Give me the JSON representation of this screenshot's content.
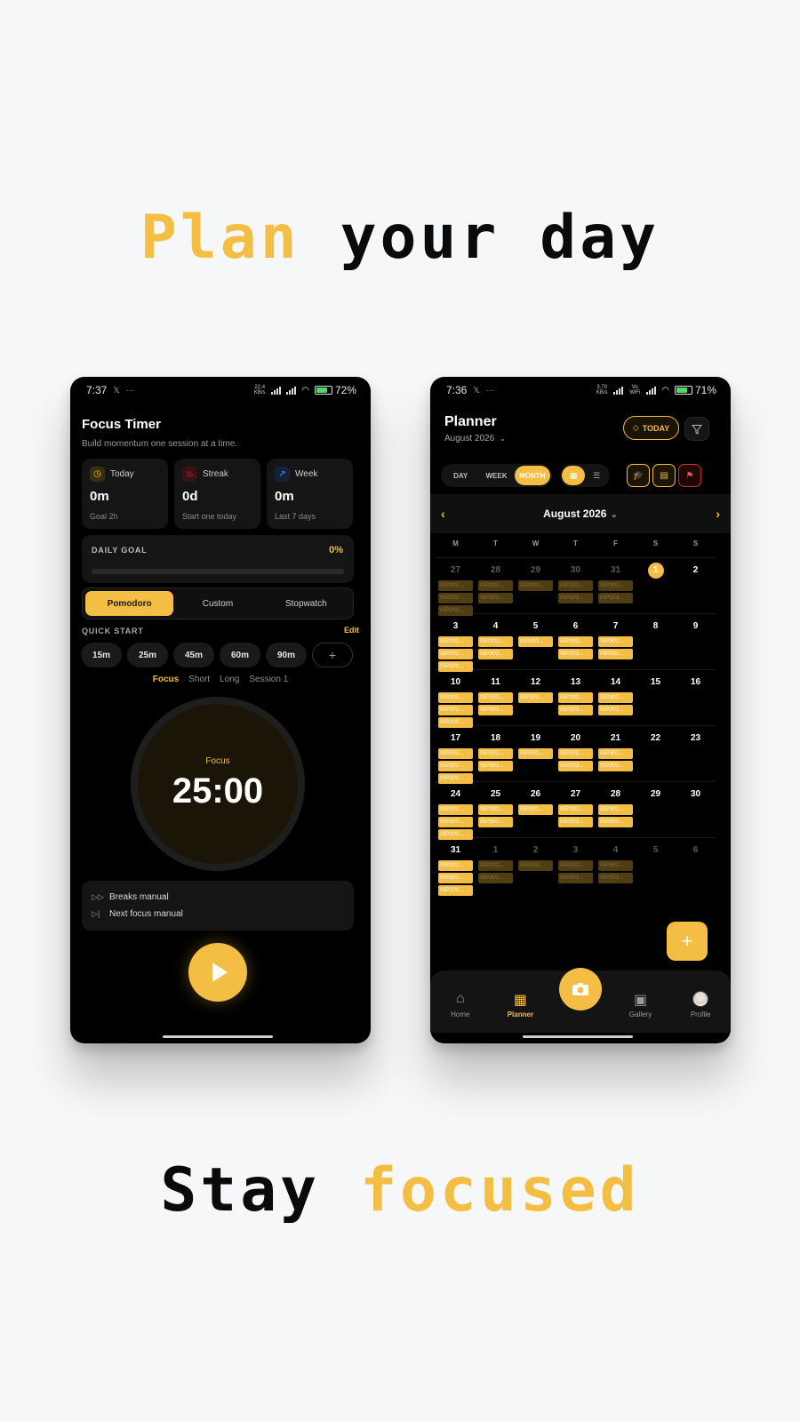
{
  "headline_top": {
    "word1": "Plan",
    "word2": "your day"
  },
  "headline_bottom": {
    "word1": "Stay",
    "word2": "focused"
  },
  "colors": {
    "accent": "#f4bd44",
    "background": "#f6f7f9",
    "phone_bg": "#000000"
  },
  "focus_phone": {
    "status": {
      "time": "7:37",
      "icon": "x-icon",
      "dots": "···",
      "net_speed": "22.4 KB/s",
      "battery": "72%"
    },
    "title": "Focus Timer",
    "subtitle": "Build momentum one session at a time.",
    "stats": [
      {
        "label": "Today",
        "value": "0m",
        "note": "Goal 2h",
        "icon": "clock-icon"
      },
      {
        "label": "Streak",
        "value": "0d",
        "note": "Start one today",
        "icon": "flame-icon"
      },
      {
        "label": "Week",
        "value": "0m",
        "note": "Last 7 days",
        "icon": "trend-icon"
      }
    ],
    "daily_goal": {
      "label": "DAILY GOAL",
      "percent": "0%",
      "progress": 0
    },
    "modes": [
      "Pomodoro",
      "Custom",
      "Stopwatch"
    ],
    "active_mode": "Pomodoro",
    "quick_start": {
      "label": "QUICK START",
      "edit": "Edit",
      "presets": [
        "15m",
        "25m",
        "45m",
        "60m",
        "90m"
      ],
      "add": "+"
    },
    "phases": [
      "Focus",
      "Short",
      "Long",
      "Session 1"
    ],
    "timer": {
      "label": "Focus",
      "time": "25:00"
    },
    "auto": [
      {
        "icon": "fast-forward-icon",
        "glyph": "▷▷",
        "text": "Breaks manual"
      },
      {
        "icon": "skip-icon",
        "glyph": "▷|",
        "text": "Next focus manual"
      }
    ]
  },
  "planner_phone": {
    "status": {
      "time": "7:36",
      "icon": "x-icon",
      "dots": "···",
      "net_speed": "3.70 KB/s",
      "network": "Vo WiFi",
      "battery": "71%"
    },
    "title": "Planner",
    "month_label": "August 2026",
    "today_button": "TODAY",
    "views": [
      "DAY",
      "WEEK",
      "MONTH"
    ],
    "active_view": "MONTH",
    "calendar_title": "August 2026",
    "weekdays": [
      "M",
      "T",
      "W",
      "T",
      "F",
      "S",
      "S"
    ],
    "weeks": [
      [
        {
          "d": "27",
          "f": true,
          "e": [
            "ISP202...",
            "ISP202...",
            "ISP203..."
          ]
        },
        {
          "d": "28",
          "f": true,
          "e": [
            "ISP202...",
            "ISP302..."
          ]
        },
        {
          "d": "29",
          "f": true,
          "e": [
            "ISP203..."
          ]
        },
        {
          "d": "30",
          "f": true,
          "e": [
            "ISP202...",
            "ISP203..."
          ]
        },
        {
          "d": "31",
          "f": true,
          "e": [
            "ISP302...",
            "ISP203..."
          ]
        },
        {
          "d": "1",
          "t": true,
          "e": []
        },
        {
          "d": "2",
          "e": []
        }
      ],
      [
        {
          "d": "3",
          "e": [
            "ISP202...",
            "ISP202...",
            "ISP203..."
          ]
        },
        {
          "d": "4",
          "e": [
            "ISP202...",
            "ISP302..."
          ]
        },
        {
          "d": "5",
          "e": [
            "ISP203..."
          ]
        },
        {
          "d": "6",
          "e": [
            "ISP202...",
            "ISP203..."
          ]
        },
        {
          "d": "7",
          "e": [
            "ISP302...",
            "ISP203..."
          ]
        },
        {
          "d": "8",
          "e": []
        },
        {
          "d": "9",
          "e": []
        }
      ],
      [
        {
          "d": "10",
          "e": [
            "ISP202...",
            "ISP202...",
            "ISP203..."
          ]
        },
        {
          "d": "11",
          "e": [
            "ISP202...",
            "ISP302..."
          ]
        },
        {
          "d": "12",
          "e": [
            "ISP203..."
          ]
        },
        {
          "d": "13",
          "e": [
            "ISP202...",
            "ISP203..."
          ]
        },
        {
          "d": "14",
          "e": [
            "ISP302...",
            "ISP203..."
          ]
        },
        {
          "d": "15",
          "e": []
        },
        {
          "d": "16",
          "e": []
        }
      ],
      [
        {
          "d": "17",
          "e": [
            "ISP202...",
            "ISP202...",
            "ISP203..."
          ]
        },
        {
          "d": "18",
          "e": [
            "ISP202...",
            "ISP302..."
          ]
        },
        {
          "d": "19",
          "e": [
            "ISP203..."
          ]
        },
        {
          "d": "20",
          "e": [
            "ISP202...",
            "ISP203..."
          ]
        },
        {
          "d": "21",
          "e": [
            "ISP302...",
            "ISP203..."
          ]
        },
        {
          "d": "22",
          "e": []
        },
        {
          "d": "23",
          "e": []
        }
      ],
      [
        {
          "d": "24",
          "e": [
            "ISP202...",
            "ISP202...",
            "ISP203..."
          ]
        },
        {
          "d": "25",
          "e": [
            "ISP202...",
            "ISP302..."
          ]
        },
        {
          "d": "26",
          "e": [
            "ISP203..."
          ]
        },
        {
          "d": "27",
          "e": [
            "ISP202...",
            "ISP203..."
          ]
        },
        {
          "d": "28",
          "e": [
            "ISP302...",
            "ISP203..."
          ]
        },
        {
          "d": "29",
          "e": []
        },
        {
          "d": "30",
          "e": []
        }
      ],
      [
        {
          "d": "31",
          "e": [
            "ISP202...",
            "ISP202...",
            "ISP203..."
          ]
        },
        {
          "d": "1",
          "f": true,
          "e": [
            "ISP202...",
            "ISP302..."
          ]
        },
        {
          "d": "2",
          "f": true,
          "e": [
            "ISP203..."
          ]
        },
        {
          "d": "3",
          "f": true,
          "e": [
            "ISP202...",
            "ISP203..."
          ]
        },
        {
          "d": "4",
          "f": true,
          "e": [
            "ISP302...",
            "ISP203..."
          ]
        },
        {
          "d": "5",
          "f": true,
          "e": []
        },
        {
          "d": "6",
          "f": true,
          "e": []
        }
      ]
    ],
    "fab": "+",
    "nav": [
      {
        "label": "Home",
        "icon": "home-icon",
        "glyph": "⌂"
      },
      {
        "label": "Planner",
        "icon": "calendar-icon",
        "glyph": "▦",
        "active": true
      },
      {
        "label": "",
        "icon": "camera-icon",
        "glyph": ""
      },
      {
        "label": "Gallery",
        "icon": "gallery-icon",
        "glyph": "▣"
      },
      {
        "label": "Profile",
        "icon": "avatar",
        "glyph": ""
      }
    ]
  }
}
